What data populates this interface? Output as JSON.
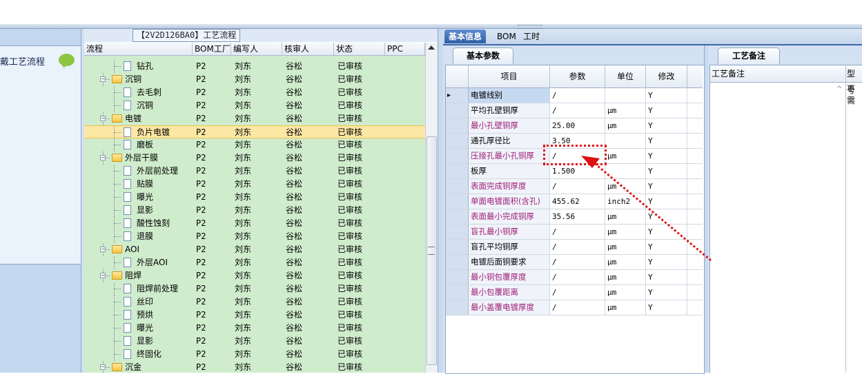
{
  "left_panel": {
    "title": "戴工艺流程",
    "bubble_icon": "speech-bubble-icon"
  },
  "grid": {
    "title": "【2V2D126BA0】工艺流程",
    "columns": [
      "流程",
      "BOM工厂",
      "编写人",
      "核审人",
      "状态",
      "PPC"
    ],
    "rows": [
      {
        "name": "钻孔",
        "level": 2,
        "type": "doc",
        "bom": "P2",
        "writer": "刘东",
        "reviewer": "谷松",
        "status": "已审核"
      },
      {
        "name": "沉铜",
        "level": 1,
        "type": "folder",
        "bom": "P2",
        "writer": "刘东",
        "reviewer": "谷松",
        "status": "已审核"
      },
      {
        "name": "去毛刺",
        "level": 2,
        "type": "doc",
        "bom": "P2",
        "writer": "刘东",
        "reviewer": "谷松",
        "status": "已审核"
      },
      {
        "name": "沉铜",
        "level": 2,
        "type": "doc",
        "bom": "P2",
        "writer": "刘东",
        "reviewer": "谷松",
        "status": "已审核"
      },
      {
        "name": "电镀",
        "level": 1,
        "type": "folder",
        "bom": "P2",
        "writer": "刘东",
        "reviewer": "谷松",
        "status": "已审核"
      },
      {
        "name": "负片电镀",
        "level": 2,
        "type": "doc",
        "bom": "P2",
        "writer": "刘东",
        "reviewer": "谷松",
        "status": "已审核",
        "selected": true
      },
      {
        "name": "磨板",
        "level": 2,
        "type": "doc",
        "bom": "P2",
        "writer": "刘东",
        "reviewer": "谷松",
        "status": "已审核"
      },
      {
        "name": "外层干膜",
        "level": 1,
        "type": "folder",
        "bom": "P2",
        "writer": "刘东",
        "reviewer": "谷松",
        "status": "已审核"
      },
      {
        "name": "外层前处理",
        "level": 2,
        "type": "doc",
        "bom": "P2",
        "writer": "刘东",
        "reviewer": "谷松",
        "status": "已审核"
      },
      {
        "name": "贴膜",
        "level": 2,
        "type": "doc",
        "bom": "P2",
        "writer": "刘东",
        "reviewer": "谷松",
        "status": "已审核"
      },
      {
        "name": "曝光",
        "level": 2,
        "type": "doc",
        "bom": "P2",
        "writer": "刘东",
        "reviewer": "谷松",
        "status": "已审核"
      },
      {
        "name": "显影",
        "level": 2,
        "type": "doc",
        "bom": "P2",
        "writer": "刘东",
        "reviewer": "谷松",
        "status": "已审核"
      },
      {
        "name": "酸性蚀刻",
        "level": 2,
        "type": "doc",
        "bom": "P2",
        "writer": "刘东",
        "reviewer": "谷松",
        "status": "已审核"
      },
      {
        "name": "退膜",
        "level": 2,
        "type": "doc",
        "bom": "P2",
        "writer": "刘东",
        "reviewer": "谷松",
        "status": "已审核"
      },
      {
        "name": "AOI",
        "level": 1,
        "type": "folder",
        "bom": "P2",
        "writer": "刘东",
        "reviewer": "谷松",
        "status": "已审核"
      },
      {
        "name": "外层AOI",
        "level": 2,
        "type": "doc",
        "bom": "P2",
        "writer": "刘东",
        "reviewer": "谷松",
        "status": "已审核"
      },
      {
        "name": "阻焊",
        "level": 1,
        "type": "folder",
        "bom": "P2",
        "writer": "刘东",
        "reviewer": "谷松",
        "status": "已审核"
      },
      {
        "name": "阻焊前处理",
        "level": 2,
        "type": "doc",
        "bom": "P2",
        "writer": "刘东",
        "reviewer": "谷松",
        "status": "已审核"
      },
      {
        "name": "丝印",
        "level": 2,
        "type": "doc",
        "bom": "P2",
        "writer": "刘东",
        "reviewer": "谷松",
        "status": "已审核"
      },
      {
        "name": "预烘",
        "level": 2,
        "type": "doc",
        "bom": "P2",
        "writer": "刘东",
        "reviewer": "谷松",
        "status": "已审核"
      },
      {
        "name": "曝光",
        "level": 2,
        "type": "doc",
        "bom": "P2",
        "writer": "刘东",
        "reviewer": "谷松",
        "status": "已审核"
      },
      {
        "name": "显影",
        "level": 2,
        "type": "doc",
        "bom": "P2",
        "writer": "刘东",
        "reviewer": "谷松",
        "status": "已审核"
      },
      {
        "name": "终固化",
        "level": 2,
        "type": "doc",
        "bom": "P2",
        "writer": "刘东",
        "reviewer": "谷松",
        "status": "已审核"
      },
      {
        "name": "沉金",
        "level": 1,
        "type": "folder",
        "bom": "P2",
        "writer": "刘东",
        "reviewer": "谷松",
        "status": "已审核"
      }
    ]
  },
  "right_tabs": [
    "基本信息",
    "BOM",
    "工时"
  ],
  "basic_params": {
    "tab_label": "基本参数",
    "columns": [
      "项目",
      "参数",
      "单位",
      "修改"
    ],
    "rows": [
      {
        "item": "电镀线别",
        "value": "/",
        "unit": "",
        "mod": "Y",
        "highlight": false,
        "current": true
      },
      {
        "item": "平均孔壁铜厚",
        "value": "/",
        "unit": "μm",
        "mod": "Y",
        "highlight": false
      },
      {
        "item": "最小孔壁铜厚",
        "value": "25.00",
        "unit": "μm",
        "mod": "Y",
        "highlight": true
      },
      {
        "item": "通孔厚径比",
        "value": "3.50",
        "unit": "",
        "mod": "Y",
        "highlight": false
      },
      {
        "item": "压接孔最小孔铜厚",
        "value": "/",
        "unit": "μm",
        "mod": "Y",
        "highlight": true
      },
      {
        "item": "板厚",
        "value": "1.500",
        "unit": "",
        "mod": "Y",
        "highlight": false
      },
      {
        "item": "表面完成铜厚度",
        "value": "/",
        "unit": "μm",
        "mod": "Y",
        "highlight": true
      },
      {
        "item": "单面电镀面积(含孔)",
        "value": "455.62",
        "unit": "inch2",
        "mod": "Y",
        "highlight": true
      },
      {
        "item": "表面最小完成铜厚",
        "value": "35.56",
        "unit": "μm",
        "mod": "Y",
        "highlight": true
      },
      {
        "item": "盲孔最小铜厚",
        "value": "/",
        "unit": "μm",
        "mod": "Y",
        "highlight": true
      },
      {
        "item": "盲孔平均铜厚",
        "value": "/",
        "unit": "μm",
        "mod": "Y",
        "highlight": false
      },
      {
        "item": "电镀后面铜要求",
        "value": "/",
        "unit": "μm",
        "mod": "Y",
        "highlight": false
      },
      {
        "item": "最小铜包覆厚度",
        "value": "/",
        "unit": "μm",
        "mod": "Y",
        "highlight": true
      },
      {
        "item": "最小包覆距离",
        "value": "/",
        "unit": "μm",
        "mod": "Y",
        "highlight": true
      },
      {
        "item": "最小盖覆电镀厚度",
        "value": "/",
        "unit": "μm",
        "mod": "Y",
        "highlight": true
      }
    ]
  },
  "remarks": {
    "tab_label": "工艺备注",
    "col1": "工艺备注",
    "col2": "型号",
    "value": "不需"
  },
  "colors": {
    "highlight_text": "#a0207a",
    "annotation": "#e01010",
    "selected_row": "#fce7a5",
    "tree_bg": "#cfeccc"
  }
}
